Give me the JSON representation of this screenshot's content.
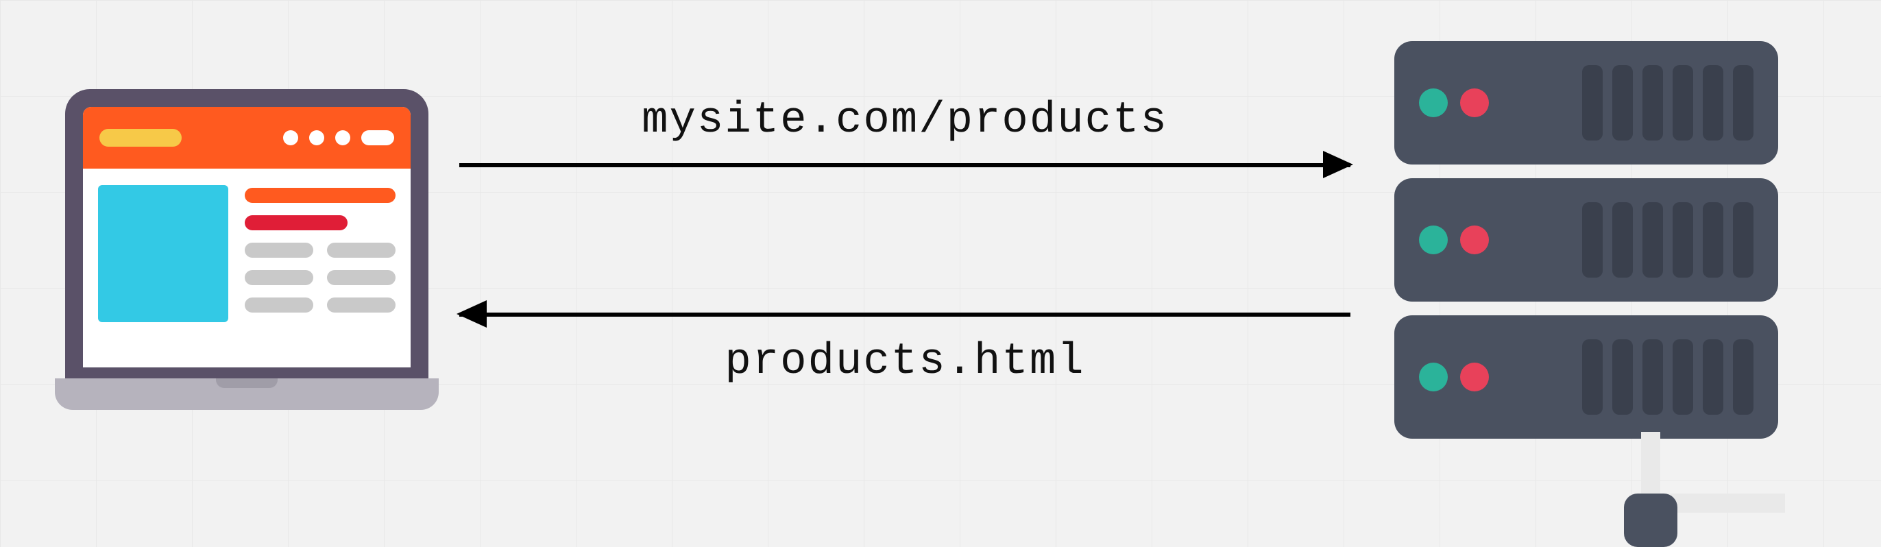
{
  "diagram": {
    "request_label": "mysite.com/products",
    "response_label": "products.html",
    "client": "laptop-browser",
    "server": "web-server"
  }
}
